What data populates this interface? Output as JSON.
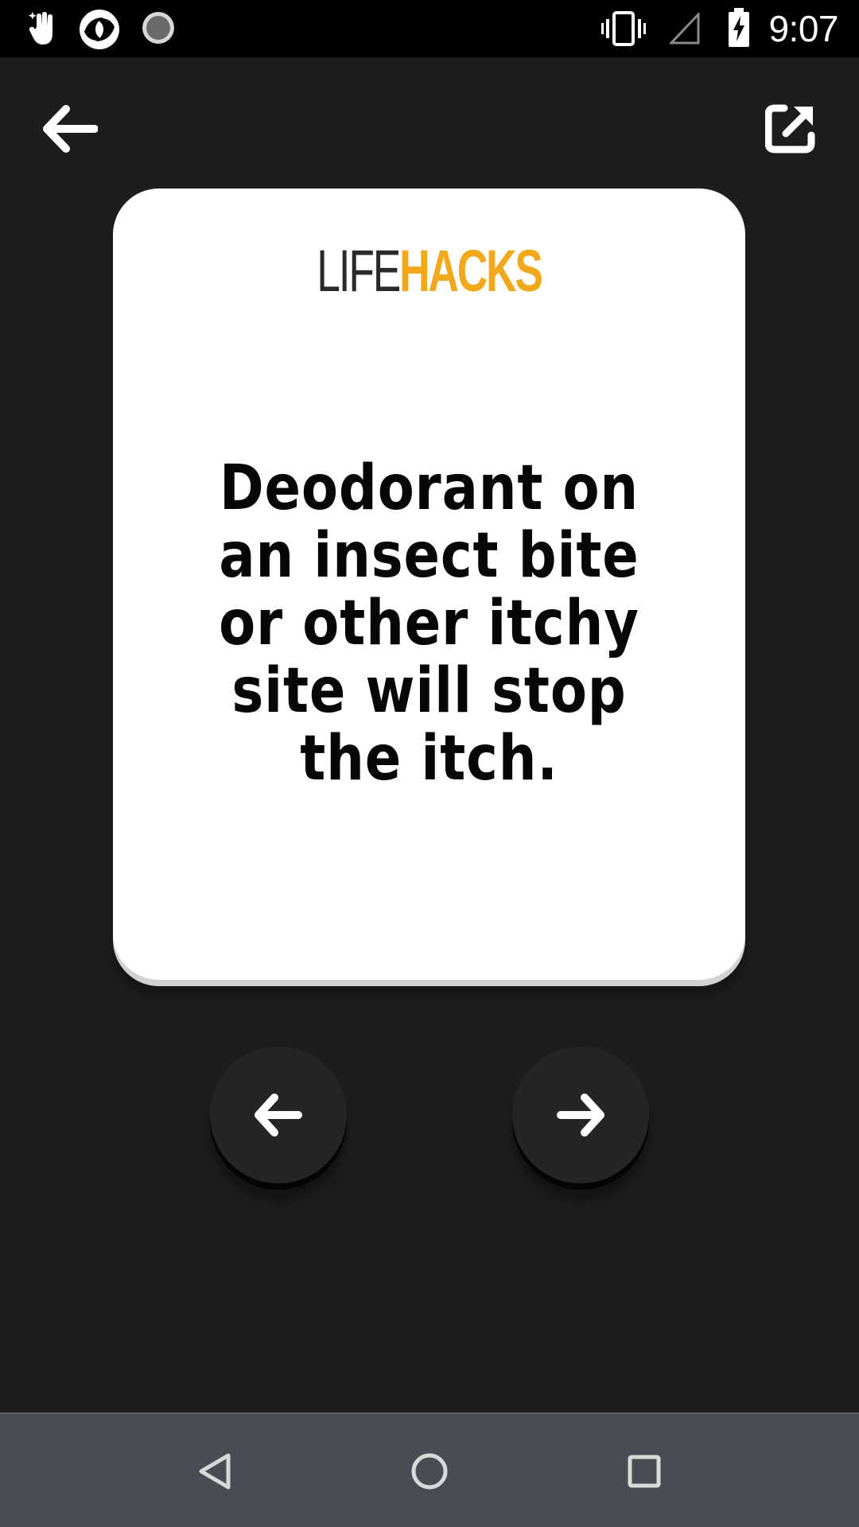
{
  "status_bar": {
    "time": "9:07",
    "icons": [
      "hand-sparkle-icon",
      "app-swirl-icon",
      "loading-spinner-icon",
      "vibrate-icon",
      "signal-empty-icon",
      "battery-charging-icon"
    ]
  },
  "toolbar": {
    "back_icon": "arrow-left-icon",
    "share_icon": "share-external-icon"
  },
  "card": {
    "logo_life": "LIFE",
    "logo_hacks": "HACKS",
    "hack_text": "Deodorant on an insect bite or other itchy site will stop the itch."
  },
  "controls": {
    "prev_icon": "arrow-left-icon",
    "next_icon": "arrow-right-icon"
  },
  "nav_bar": {
    "icons": [
      "nav-back-icon",
      "nav-home-icon",
      "nav-recents-icon"
    ]
  },
  "colors": {
    "background": "#1d1d1f",
    "card": "#ffffff",
    "accent": "#f1a81b",
    "nav_bar": "#474d52"
  }
}
